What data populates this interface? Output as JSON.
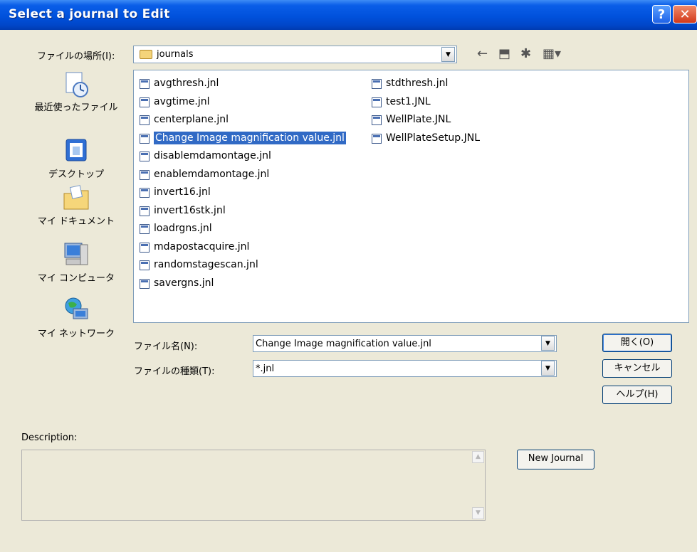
{
  "window": {
    "title": "Select a journal to Edit",
    "help_label": "?",
    "close_label": "✕"
  },
  "look_in": {
    "label": "ファイルの場所(I):",
    "value": "journals",
    "back_glyph": "←",
    "up_glyph": "⬒",
    "newfolder_glyph": "✱",
    "views_glyph": "▦▾"
  },
  "places": [
    {
      "label": "最近使ったファイル",
      "icon": "recent-icon"
    },
    {
      "label": "デスクトップ",
      "icon": "desktop-icon"
    },
    {
      "label": "マイ ドキュメント",
      "icon": "documents-icon"
    },
    {
      "label": "マイ コンピュータ",
      "icon": "computer-icon"
    },
    {
      "label": "マイ ネットワーク",
      "icon": "network-icon"
    }
  ],
  "files": {
    "column1": [
      "avgthresh.jnl",
      "avgtime.jnl",
      "centerplane.jnl",
      "Change Image magnification value.jnl",
      "disablemdamontage.jnl",
      "enablemdamontage.jnl",
      "invert16.jnl",
      "invert16stk.jnl",
      "loadrgns.jnl",
      "mdapostacquire.jnl",
      "randomstagescan.jnl",
      "savergns.jnl"
    ],
    "column2": [
      "stdthresh.jnl",
      "test1.JNL",
      "WellPlate.JNL",
      "WellPlateSetup.JNL"
    ],
    "selected": "Change Image magnification value.jnl"
  },
  "filename": {
    "label": "ファイル名(N):",
    "value": "Change Image magnification value.jnl"
  },
  "filetype": {
    "label": "ファイルの種類(T):",
    "value": "*.jnl"
  },
  "buttons": {
    "open": "開く(O)",
    "cancel": "キャンセル",
    "help": "ヘルプ(H)",
    "new_journal": "New Journal"
  },
  "description": {
    "label": "Description:",
    "value": ""
  },
  "colors": {
    "titlebar": "#0051dc",
    "dialog_bg": "#ece9d8",
    "selection": "#316ac5"
  }
}
